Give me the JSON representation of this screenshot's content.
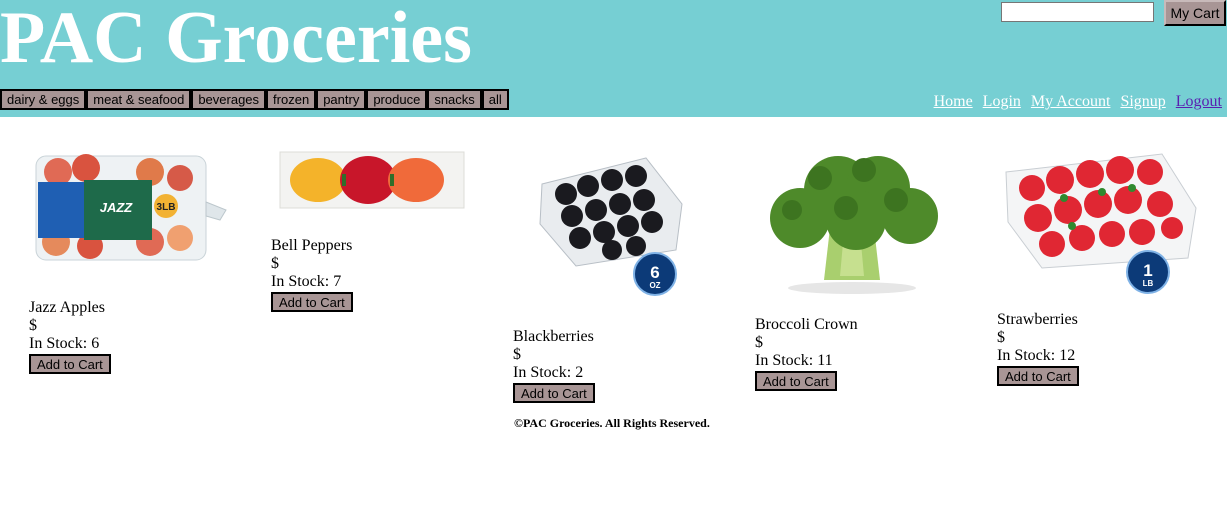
{
  "header": {
    "title": "PAC Groceries",
    "search_placeholder": "",
    "cart_label": "My Cart",
    "background": "#76cfd3"
  },
  "categories": [
    "dairy & eggs",
    "meat & seafood",
    "beverages",
    "frozen",
    "pantry",
    "produce",
    "snacks",
    "all"
  ],
  "nav_links": [
    "Home",
    "Login",
    "My Account",
    "Signup",
    "Logout"
  ],
  "products": [
    {
      "name": "Jazz Apples",
      "price": "$",
      "stock": "In Stock: 6",
      "button": "Add to Cart",
      "image": "apples-bag",
      "badge": "3LB"
    },
    {
      "name": "Bell Peppers",
      "price": "$",
      "stock": "In Stock: 7",
      "button": "Add to Cart",
      "image": "bell-peppers-pack"
    },
    {
      "name": "Blackberries",
      "price": "$",
      "stock": "In Stock: 2",
      "button": "Add to Cart",
      "image": "blackberries-clamshell",
      "badge_num": "6",
      "badge_unit": "OZ"
    },
    {
      "name": "Broccoli Crown",
      "price": "$",
      "stock": "In Stock: 11",
      "button": "Add to Cart",
      "image": "broccoli"
    },
    {
      "name": "Strawberries",
      "price": "$",
      "stock": "In Stock: 12",
      "button": "Add to Cart",
      "image": "strawberries-clamshell",
      "badge_num": "1",
      "badge_unit": "LB"
    }
  ],
  "footer": "©PAC Groceries. All Rights Reserved."
}
